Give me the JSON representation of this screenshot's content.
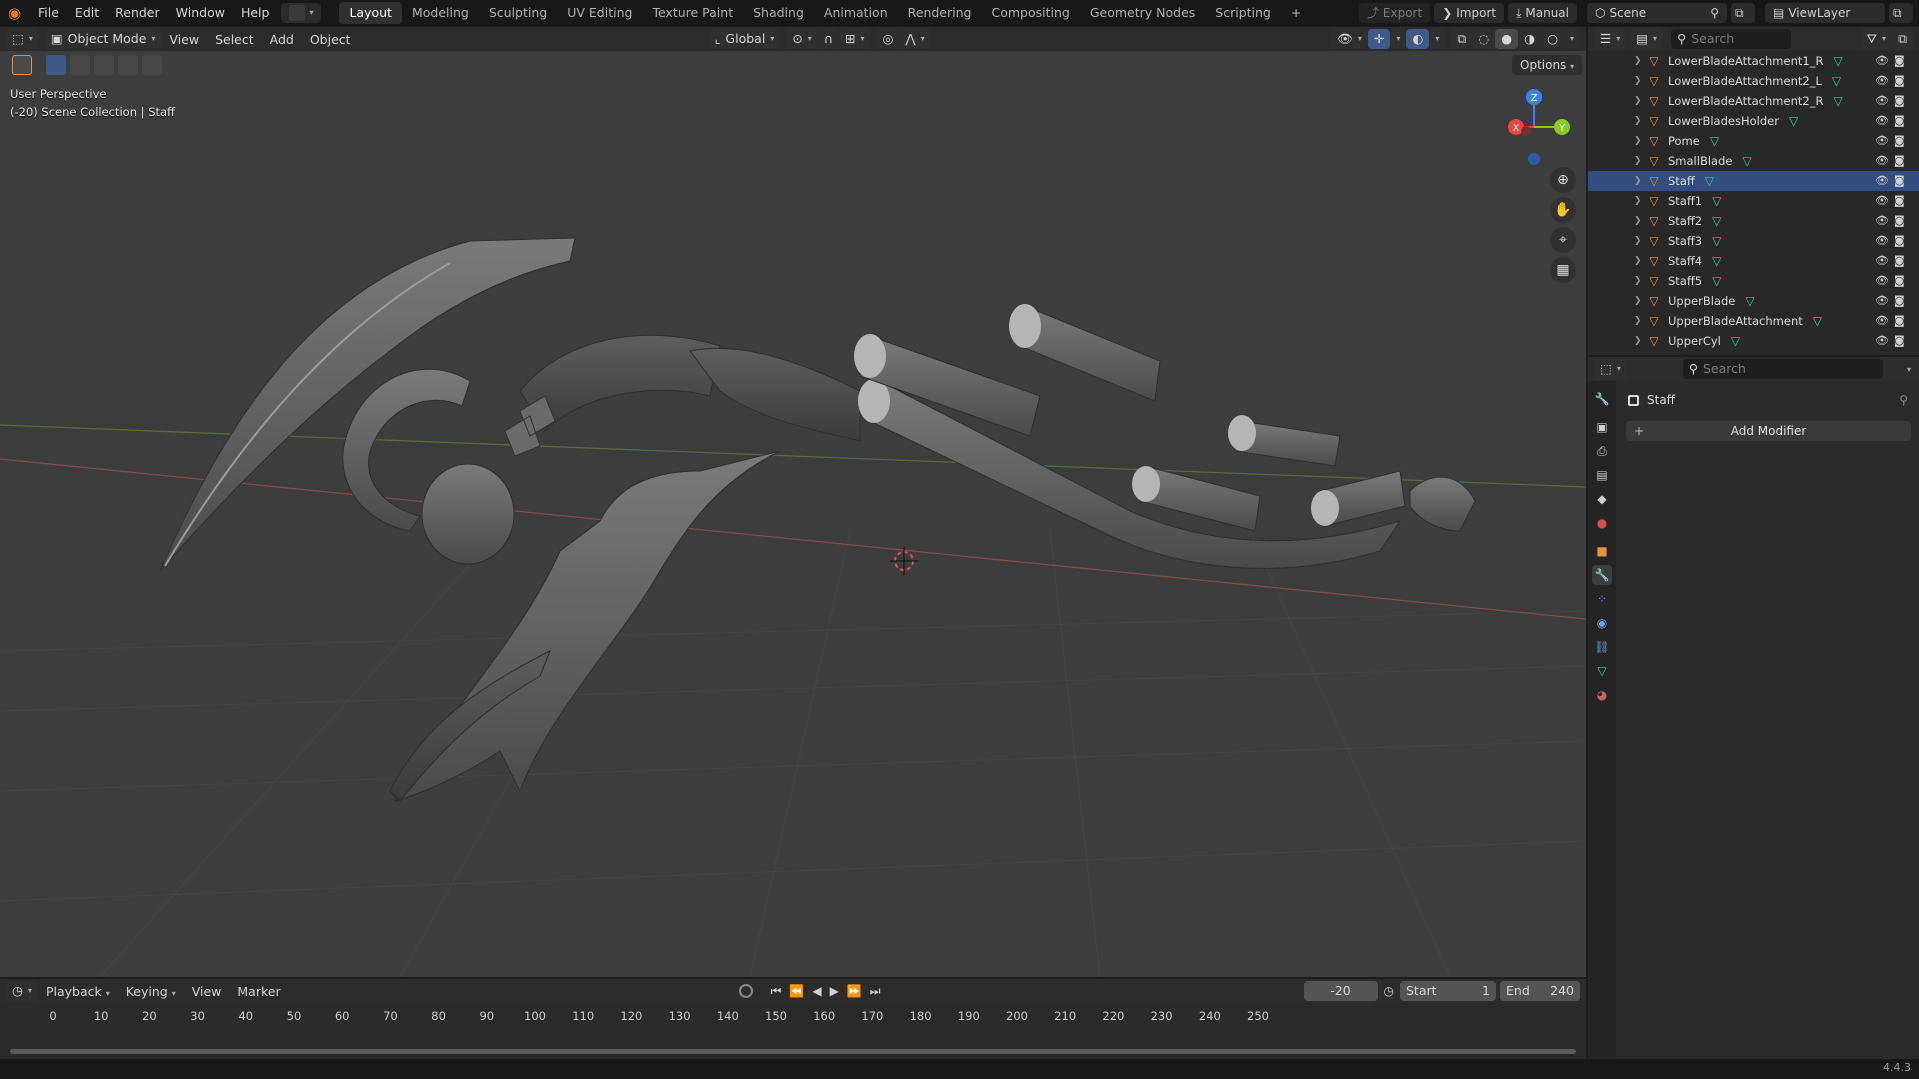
{
  "topbar": {
    "menus": [
      "File",
      "Edit",
      "Render",
      "Window",
      "Help"
    ],
    "workspaces": [
      "Layout",
      "Modeling",
      "Sculpting",
      "UV Editing",
      "Texture Paint",
      "Shading",
      "Animation",
      "Rendering",
      "Compositing",
      "Geometry Nodes",
      "Scripting"
    ],
    "active_workspace": "Layout",
    "add_tab": "+",
    "export_label": "Export",
    "import_label": "Import",
    "manual_label": "Manual",
    "scene_label": "Scene",
    "viewlayer_label": "ViewLayer"
  },
  "viewport": {
    "mode_label": "Object Mode",
    "menus": [
      "View",
      "Select",
      "Add",
      "Object"
    ],
    "orientation_label": "Global",
    "options_label": "Options",
    "overlay_line1": "User Perspective",
    "overlay_line2": "(-20) Scene Collection | Staff",
    "gizmo": {
      "z": "Z",
      "y": "Y",
      "x": "X"
    },
    "colors": {
      "background": "#3d3d3d",
      "x_axis": "#ee4444",
      "y_axis": "#88cc22",
      "z_axis": "#3b82f6"
    }
  },
  "outliner": {
    "search_placeholder": "Search",
    "items": [
      {
        "name": "LowerBladeAttachment1_R",
        "active": false
      },
      {
        "name": "LowerBladeAttachment2_L",
        "active": false
      },
      {
        "name": "LowerBladeAttachment2_R",
        "active": false
      },
      {
        "name": "LowerBladesHolder",
        "active": false
      },
      {
        "name": "Pome",
        "active": false
      },
      {
        "name": "SmallBlade",
        "active": false
      },
      {
        "name": "Staff",
        "active": true
      },
      {
        "name": "Staff1",
        "active": false
      },
      {
        "name": "Staff2",
        "active": false
      },
      {
        "name": "Staff3",
        "active": false
      },
      {
        "name": "Staff4",
        "active": false
      },
      {
        "name": "Staff5",
        "active": false
      },
      {
        "name": "UpperBlade",
        "active": false
      },
      {
        "name": "UpperBladeAttachment",
        "active": false
      },
      {
        "name": "UpperCyl",
        "active": false
      }
    ]
  },
  "properties": {
    "search_placeholder": "Search",
    "object_name": "Staff",
    "add_modifier_label": "Add Modifier"
  },
  "timeline": {
    "menus": [
      "Playback",
      "Keying",
      "View",
      "Marker"
    ],
    "current_frame": "-20",
    "start_label": "Start",
    "start_value": "1",
    "end_label": "End",
    "end_value": "240",
    "frame_ticks": [
      "0",
      "10",
      "20",
      "30",
      "40",
      "50",
      "60",
      "70",
      "80",
      "90",
      "100",
      "110",
      "120",
      "130",
      "140",
      "150",
      "160",
      "170",
      "180",
      "190",
      "200",
      "210",
      "220",
      "230",
      "240",
      "250"
    ]
  },
  "status": {
    "version": "4.4.3"
  }
}
